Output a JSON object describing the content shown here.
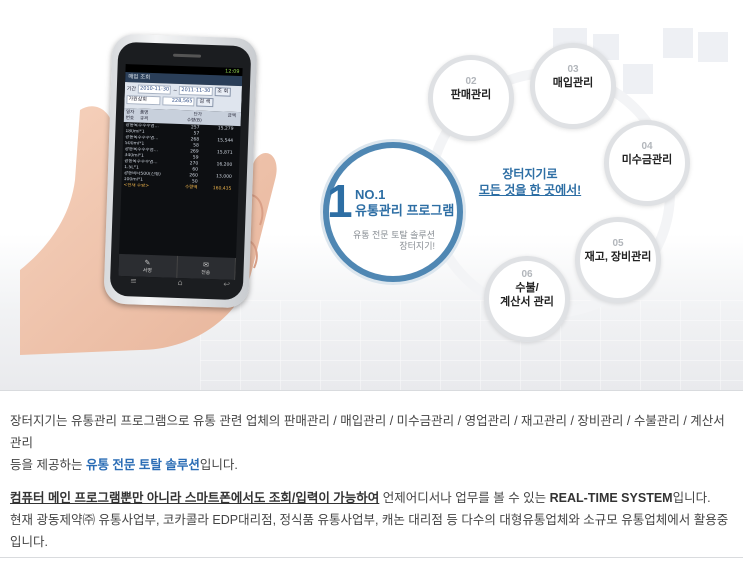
{
  "phone": {
    "status_time": "12:09",
    "app_title": "매입 조회",
    "period_label": "기간",
    "date_from": "2010-11-30",
    "date_to": "2011-11-30",
    "date_sep": "~",
    "query_button": "조 회",
    "vendor_value": "가원상회",
    "amount_value": "228,565",
    "search_button": "검 색",
    "headers": {
      "c1": "일자",
      "c1b": "번호",
      "c2": "품명",
      "c2b": "규격",
      "c3": "단가",
      "c3b": "수량(B)",
      "c4": "금액"
    },
    "rows": [
      {
        "a": "광동옥수수수염...",
        "b": "257",
        "c": "15,279"
      },
      {
        "a": "180ml*1",
        "b": "57",
        "c": ""
      },
      {
        "a": "광동옥수수수염...",
        "b": "268",
        "c": "15,544"
      },
      {
        "a": "500ml*1",
        "b": "58",
        "c": ""
      },
      {
        "a": "광동옥수수수염...",
        "b": "269",
        "c": "15,871"
      },
      {
        "a": "340ml*1",
        "b": "59",
        "c": ""
      },
      {
        "a": "광동옥수수수염...",
        "b": "270",
        "c": "16,200"
      },
      {
        "a": "1.5L*1",
        "b": "60",
        "c": ""
      },
      {
        "a": "광동비타500(신형)",
        "b": "260",
        "c": "13,000"
      },
      {
        "a": "100ml*1",
        "b": "50",
        "c": ""
      }
    ],
    "total_label": "<현재 수량>",
    "total_sub": "수량액",
    "total_value": "160,435",
    "softkey_left": "서명",
    "softkey_right": "전송"
  },
  "hero": {
    "big_number": "1",
    "big_title_line1": "NO.1",
    "big_title_line2": "유통관리 프로그램",
    "big_sub_line1": "유통 전문 토탈 솔루션",
    "big_sub_line2": "장터지기!",
    "center_line1": "장터지기로",
    "center_line2": "모든 것을 한 곳에서!",
    "nodes": [
      {
        "num": "02",
        "label": "판매관리"
      },
      {
        "num": "03",
        "label": "매입관리"
      },
      {
        "num": "04",
        "label": "미수금관리"
      },
      {
        "num": "05",
        "label": "재고, 장비관리"
      },
      {
        "num": "06",
        "label_line1": "수불/",
        "label_line2": "계산서 관리"
      }
    ]
  },
  "description": {
    "p1_line1": "장터지기는 유통관리 프로그램으로 유통 관련 업체의 판매관리 / 매입관리 / 미수금관리 / 영업관리 / 재고관리 / 장비관리 / 수불관리 / 계산서관리",
    "p1_line2_a": "등을 제공하는 ",
    "p1_line2_b": "유통 전문 토탈 솔루션",
    "p1_line2_c": "입니다.",
    "p2_line1_a": "컴퓨터 메인 프로그램뿐만 아니라 스마트폰에서도 조회/입력이 가능하여",
    "p2_line1_b": " 언제어디서나 업무를 볼 수 있는 ",
    "p2_line1_c": "REAL-TIME SYSTEM",
    "p2_line1_d": "입니다.",
    "p2_line2": "현재 광동제약㈜ 유통사업부, 코카콜라 EDP대리점, 정식품 유통사업부, 캐논 대리점 등 다수의 대형유통업체와 소규모 유통업체에서 활용중입니다."
  },
  "colors": {
    "accent": "#2d6ea4",
    "highlight": "#2a6cb5",
    "ring": "#4f87b3"
  }
}
